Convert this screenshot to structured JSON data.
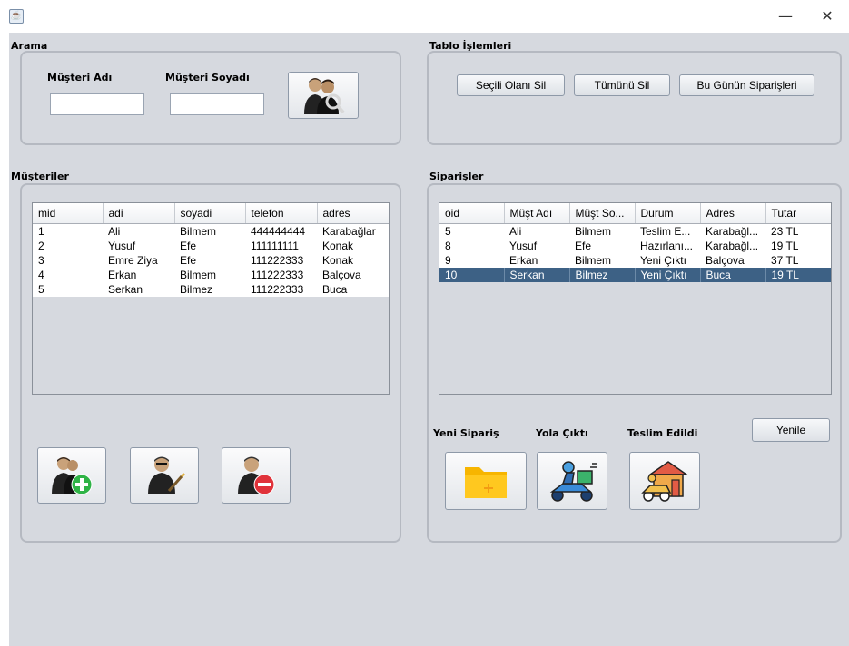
{
  "window": {
    "icon": "java-icon",
    "minimize": "—",
    "maximize": "☐",
    "close": "✕"
  },
  "search": {
    "title": "Arama",
    "first_name_label": "Müşteri Adı",
    "last_name_label": "Müşteri Soyadı",
    "first_name_value": "",
    "last_name_value": "",
    "search_icon": "customer-search-icon"
  },
  "table_ops": {
    "title": "Tablo İşlemleri",
    "delete_selected": "Seçili Olanı Sil",
    "delete_all": "Tümünü Sil",
    "todays_orders": "Bu Günün Siparişleri"
  },
  "customers": {
    "title": "Müşteriler",
    "columns": [
      "mid",
      "adi",
      "soyadi",
      "telefon",
      "adres"
    ],
    "rows": [
      [
        "1",
        "Ali",
        "Bilmem",
        "444444444",
        "Karabağlar"
      ],
      [
        "2",
        "Yusuf",
        "Efe",
        "111111111",
        "Konak"
      ],
      [
        "3",
        "Emre Ziya",
        "Efe",
        "111222333",
        "Konak"
      ],
      [
        "4",
        "Erkan",
        "Bilmem",
        "111222333",
        "Balçova"
      ],
      [
        "5",
        "Serkan",
        "Bilmez",
        "111222333",
        "Buca"
      ]
    ],
    "add_icon": "add-customer-icon",
    "edit_icon": "edit-customer-icon",
    "delete_icon": "delete-customer-icon"
  },
  "orders": {
    "title": "Siparişler",
    "columns": [
      "oid",
      "Müşt Adı",
      "Müşt So...",
      "Durum",
      "Adres",
      "Tutar"
    ],
    "rows": [
      [
        "5",
        "Ali",
        "Bilmem",
        "Teslim E...",
        "Karabağl...",
        "23 TL"
      ],
      [
        "8",
        "Yusuf",
        "Efe",
        "Hazırlanı...",
        "Karabağl...",
        "19 TL"
      ],
      [
        "9",
        "Erkan",
        "Bilmem",
        "Yeni Çıktı",
        "Balçova",
        "37 TL"
      ],
      [
        "10",
        "Serkan",
        "Bilmez",
        "Yeni Çıktı",
        "Buca",
        "19 TL"
      ]
    ],
    "selected_row": 3,
    "new_order_label": "Yeni Sipariş",
    "on_the_way_label": "Yola Çıktı",
    "delivered_label": "Teslim Edildi",
    "refresh": "Yenile",
    "new_order_icon": "new-folder-icon",
    "on_the_way_icon": "delivery-scooter-icon",
    "delivered_icon": "delivered-home-icon"
  }
}
